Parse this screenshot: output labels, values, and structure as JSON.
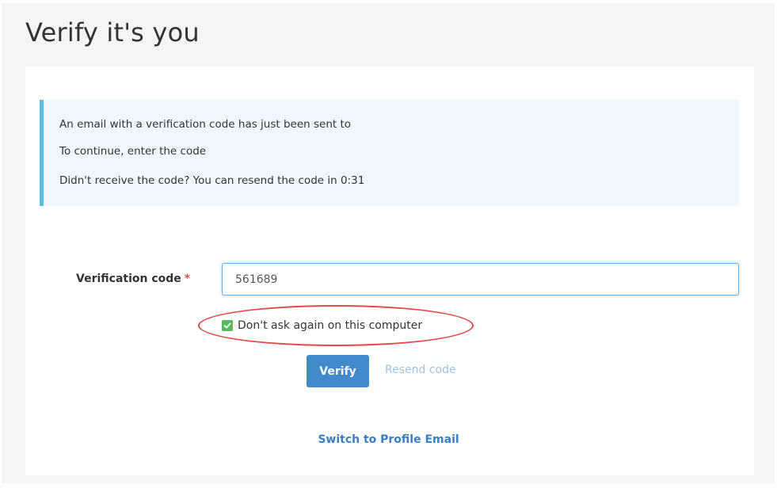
{
  "page": {
    "title": "Verify it's you"
  },
  "info": {
    "line1": "An email with a verification code has just been sent to",
    "line2": "To continue, enter the code",
    "line3": "Didn't receive the code? You can resend the code in 0:31",
    "accent_color": "#5bc0de"
  },
  "form": {
    "code_label": "Verification code",
    "required_marker": "*",
    "code_value": "561689",
    "remember_label": "Don't ask again on this computer",
    "remember_checked": true,
    "verify_label": "Verify",
    "resend_label": "Resend code",
    "switch_label": "Switch to Profile Email"
  },
  "icons": {
    "checkbox": "checked-checkbox-icon"
  },
  "colors": {
    "primary": "#428bca",
    "checkbox": "#5cb85c",
    "annotation": "#e04a4a",
    "required": "#d9534f"
  }
}
